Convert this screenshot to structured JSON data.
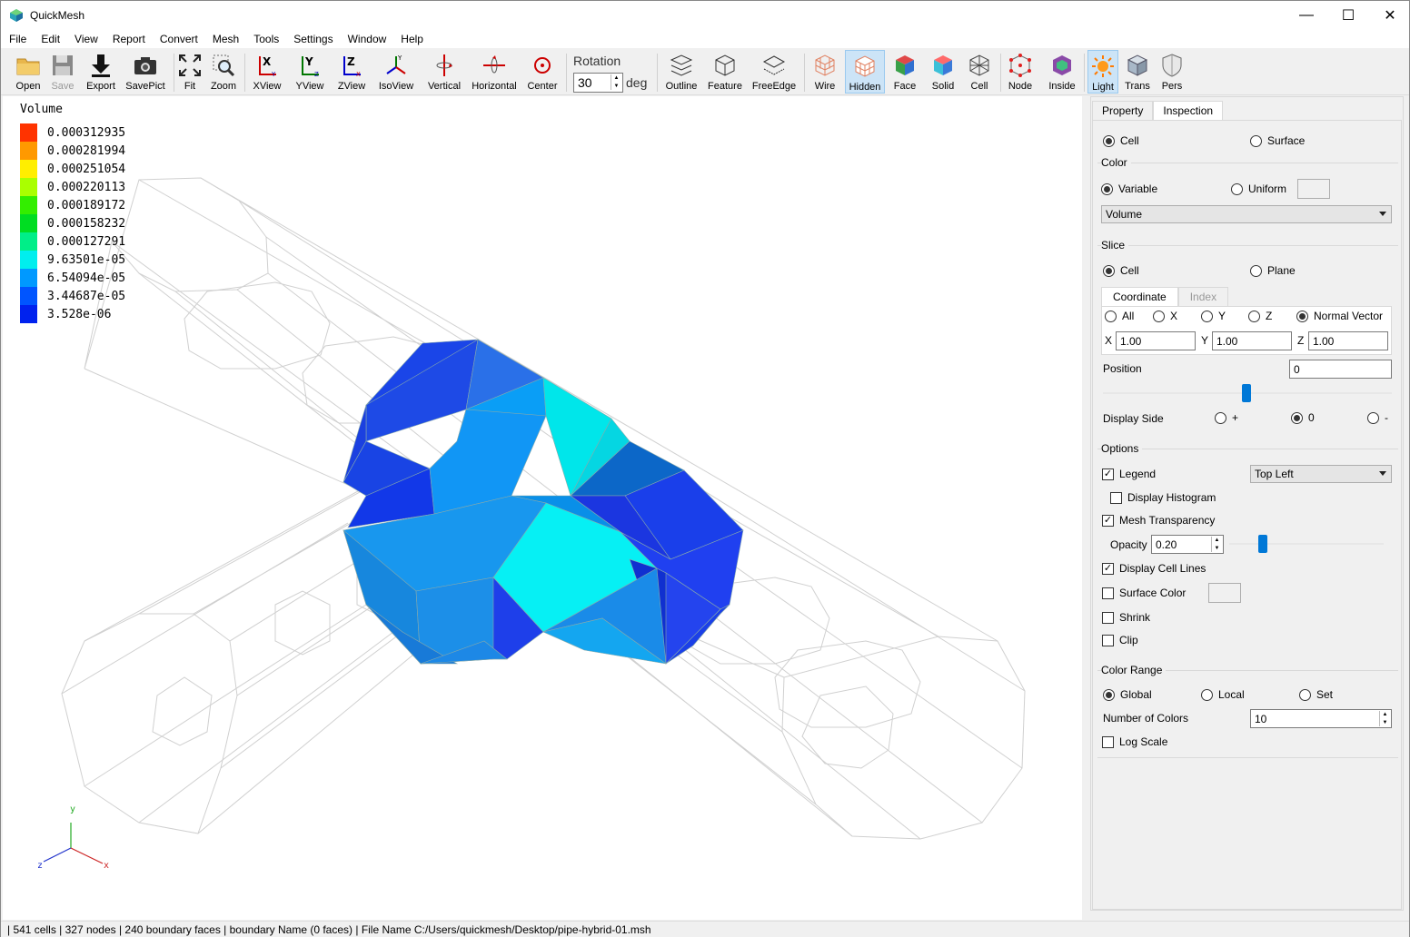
{
  "window": {
    "title": "QuickMesh",
    "minimize": "—",
    "maximize": "☐",
    "close": "✕"
  },
  "menu": [
    "File",
    "Edit",
    "View",
    "Report",
    "Convert",
    "Mesh",
    "Tools",
    "Settings",
    "Window",
    "Help"
  ],
  "toolbar": {
    "open": "Open",
    "save": "Save",
    "export": "Export",
    "savepict": "SavePict",
    "fit": "Fit",
    "zoom": "Zoom",
    "xview": "XView",
    "yview": "YView",
    "zview": "ZView",
    "isoview": "IsoView",
    "vertical": "Vertical",
    "horizontal": "Horizontal",
    "center": "Center",
    "rotation_label": "Rotation",
    "rotation_value": "30",
    "rotation_unit": "deg",
    "outline": "Outline",
    "feature": "Feature",
    "freeedge": "FreeEdge",
    "wire": "Wire",
    "hidden": "Hidden",
    "face": "Face",
    "solid": "Solid",
    "cell": "Cell",
    "node": "Node",
    "inside": "Inside",
    "light": "Light",
    "trans": "Trans",
    "pers": "Pers"
  },
  "legend": {
    "title": "Volume",
    "entries": [
      {
        "value": "0.000312935",
        "color": "#ff3300"
      },
      {
        "value": "0.000281994",
        "color": "#ff9900"
      },
      {
        "value": "0.000251054",
        "color": "#ffee00"
      },
      {
        "value": "0.000220113",
        "color": "#aaff00"
      },
      {
        "value": "0.000189172",
        "color": "#33ee00"
      },
      {
        "value": "0.000158232",
        "color": "#00dd22"
      },
      {
        "value": "0.000127291",
        "color": "#00ee88"
      },
      {
        "value": "9.63501e-05",
        "color": "#00eeee"
      },
      {
        "value": "6.54094e-05",
        "color": "#0099ff"
      },
      {
        "value": "3.44687e-05",
        "color": "#0055ff"
      },
      {
        "value": "3.528e-06",
        "color": "#0022ee"
      }
    ]
  },
  "axes": {
    "y": "y",
    "x": "x",
    "z": "z"
  },
  "panel": {
    "tabs": [
      "Property",
      "Inspection"
    ],
    "selected_tab": "Inspection",
    "mode": {
      "cell": "Cell",
      "surface": "Surface"
    },
    "color": {
      "title": "Color",
      "variable": "Variable",
      "uniform": "Uniform",
      "variable_select": "Volume"
    },
    "slice": {
      "title": "Slice",
      "cell": "Cell",
      "plane": "Plane",
      "subtabs": [
        "Coordinate",
        "Index"
      ],
      "all": "All",
      "x": "X",
      "y": "Y",
      "z": "Z",
      "normal": "Normal Vector",
      "x_label": "X",
      "y_label": "Y",
      "z_label": "Z",
      "x_val": "1.00",
      "y_val": "1.00",
      "z_val": "1.00",
      "position_label": "Position",
      "position_val": "0",
      "display_side": "Display Side",
      "plus": "+",
      "zero": "0",
      "minus": "-"
    },
    "options": {
      "title": "Options",
      "legend": "Legend",
      "legend_pos": "Top Left",
      "histogram": "Display Histogram",
      "mesh_transparency": "Mesh Transparency",
      "opacity_label": "Opacity",
      "opacity_val": "0.20",
      "cell_lines": "Display Cell Lines",
      "surface_color": "Surface Color",
      "shrink": "Shrink",
      "clip": "Clip"
    },
    "range": {
      "title": "Color Range",
      "global": "Global",
      "local": "Local",
      "set": "Set",
      "num_colors_label": "Number of Colors",
      "num_colors_val": "10",
      "log_scale": "Log Scale"
    }
  },
  "status": "| 541 cells | 327 nodes | 240 boundary faces |  boundary Name  (0 faces) | File Name C:/Users/quickmesh/Desktop/pipe-hybrid-01.msh"
}
